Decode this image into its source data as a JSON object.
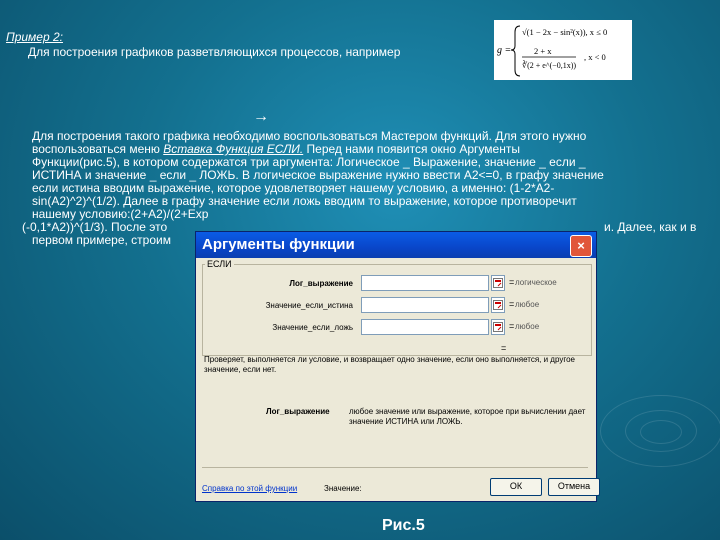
{
  "slide": {
    "example_title": "Пример 2:",
    "intro": "Для построения графиков разветвляющихся процессов, например",
    "arrow": "→",
    "paragraph": {
      "line1": "Для построения такого графика необходимо воспользоваться Мастером функций. Для этого нужно",
      "line2_pre": "воспользоваться меню ",
      "line2_link": "Вставка       Функция  ЕСЛИ.",
      "line2_post": " Перед нами появится окно Аргументы",
      "line3": "Функции(рис.5), в котором содержатся три аргумента: Логическое _ Выражение, значение _ если _",
      "line4": "ИСТИНА и значение _ если _ ЛОЖЬ. В логическое выражение нужно ввести  A2<=0, в графу значение",
      "line5": "если истина вводим выражение, которое удовлетворяет нашему условию, а именно: (1-2*A2-",
      "line6": "sin(A2)^2)^(1/2). Далее в графу значение если ложь вводим то выражение, которое противоречит",
      "line7": "нашему условию:(2+A2)/(2+Exp",
      "line8": "(-0,1*A2))^(1/3). После это",
      "line8_tail": "и. Далее, как и в",
      "line9": "первом примере, строим"
    },
    "figure_caption": "Рис.5"
  },
  "formula": {
    "lhs": "g =",
    "case1": "√(1 − 2x − sin²(x)), x ≤ 0",
    "case2_num": "2 + x",
    "case2_den": "∛(2 + e^(−0,1x))",
    "case2_cond": ", x < 0"
  },
  "dialog": {
    "title": "Аргументы функции",
    "close_symbol": "×",
    "function_name": "ЕСЛИ",
    "args": [
      {
        "label": "Лог_выражение",
        "value": "",
        "type": "логическое"
      },
      {
        "label": "Значение_если_истина",
        "value": "",
        "type": "любое"
      },
      {
        "label": "Значение_если_ложь",
        "value": "",
        "type": "любое"
      }
    ],
    "equals": "=",
    "result_equals": "=",
    "description": "Проверяет, выполняется ли условие, и возвращает одно значение, если оно выполняется, и другое значение, если нет.",
    "arg_desc_name": "Лог_выражение",
    "arg_desc_text": "любое значение или выражение, которое при вычислении дает значение ИСТИНА или ЛОЖЬ.",
    "help_link": "Справка по этой функции",
    "value_label": "Значение:",
    "ok_label": "ОК",
    "cancel_label": "Отмена"
  }
}
